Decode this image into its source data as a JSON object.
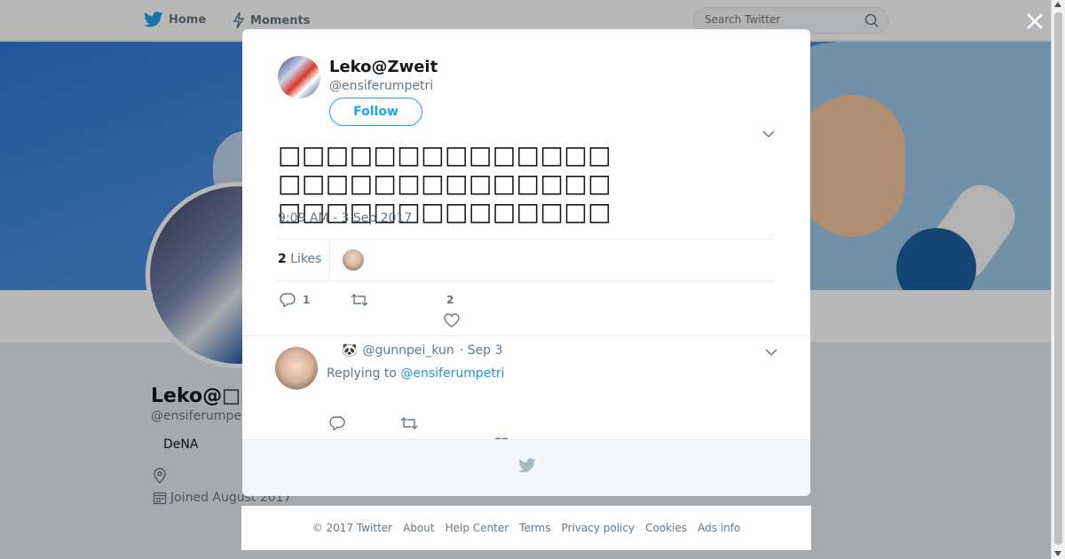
{
  "nav": {
    "home_label": "Home",
    "moments_label": "Moments",
    "search_placeholder": "Search Twitter"
  },
  "profile": {
    "name": "Leko@□□",
    "handle": "@ensiferumpe",
    "bio": "DeNA",
    "joined": "Joined August 2017"
  },
  "tweet": {
    "author_name": "Leko@Zweit",
    "author_handle": "@ensiferumpetri",
    "follow_label": "Follow",
    "text": "□□□□□□□□□□□□□□□□□□□□□□□□□□□□□□□□□□□□□□□□□□",
    "timestamp": "9:09 AM - 3 Sep 2017",
    "likes_count": "2",
    "likes_label": "Likes",
    "reply_count": "1",
    "retweet_count": "",
    "like_count": "2"
  },
  "reply": {
    "display_emoji": "🐼",
    "handle": "@gunnpei_kun",
    "date": "· Sep 3",
    "replying_to_label": "Replying to",
    "replying_to_handle": "@ensiferumpetri"
  },
  "footer": {
    "links": [
      "© 2017 Twitter",
      "About",
      "Help Center",
      "Terms",
      "Privacy policy",
      "Cookies",
      "Ads info"
    ]
  },
  "colors": {
    "accent": "#1da1f2",
    "link": "#1b95e0",
    "muted": "#657786",
    "banner": "#3d7fd6"
  }
}
